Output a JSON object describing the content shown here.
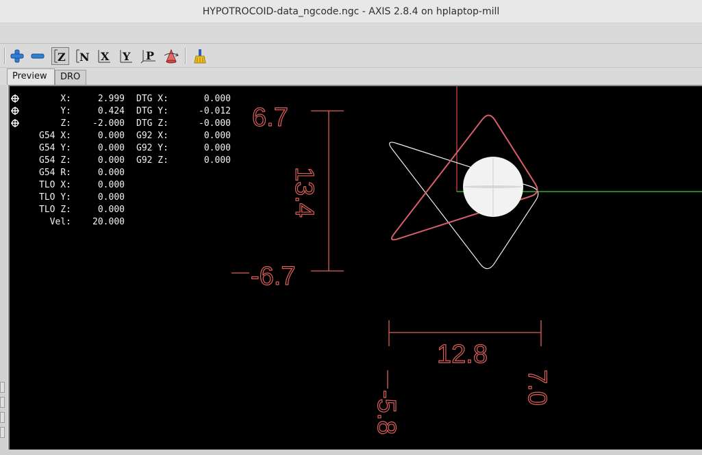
{
  "window": {
    "title": "HYPOTROCOID-data_ngcode.ngc - AXIS 2.8.4 on hplaptop-mill"
  },
  "toolbar": {
    "buttons": [
      {
        "name": "zoom-in-button",
        "icon": "plus-icon"
      },
      {
        "name": "zoom-out-button",
        "icon": "minus-icon"
      },
      {
        "name": "view-z-button",
        "icon": "z-view-icon",
        "label": "Z",
        "active": true
      },
      {
        "name": "view-z-rotated-button",
        "icon": "z-rotated-view-icon",
        "label": "N"
      },
      {
        "name": "view-x-button",
        "icon": "x-view-icon",
        "label": "X"
      },
      {
        "name": "view-y-button",
        "icon": "y-view-icon",
        "label": "Y"
      },
      {
        "name": "view-perspective-button",
        "icon": "perspective-view-icon",
        "label": "P"
      },
      {
        "name": "rotate-view-button",
        "icon": "cone-icon"
      },
      {
        "name": "clear-backplot-button",
        "icon": "broom-icon"
      }
    ]
  },
  "tabs": [
    {
      "label": "Preview",
      "active": true
    },
    {
      "label": "DRO",
      "active": false
    }
  ],
  "dro": {
    "rows": [
      {
        "homed": true,
        "label": "X:",
        "value": "2.999",
        "label2": "DTG X:",
        "value2": "0.000"
      },
      {
        "homed": true,
        "label": "Y:",
        "value": "0.424",
        "label2": "DTG Y:",
        "value2": "-0.012"
      },
      {
        "homed": true,
        "label": "Z:",
        "value": "-2.000",
        "label2": "DTG Z:",
        "value2": "-0.000"
      },
      {
        "homed": false,
        "label": "G54 X:",
        "value": "0.000",
        "label2": "G92 X:",
        "value2": "0.000"
      },
      {
        "homed": false,
        "label": "G54 Y:",
        "value": "0.000",
        "label2": "G92 Y:",
        "value2": "0.000"
      },
      {
        "homed": false,
        "label": "G54 Z:",
        "value": "0.000",
        "label2": "G92 Z:",
        "value2": "0.000"
      },
      {
        "homed": false,
        "label": "G54 R:",
        "value": "0.000",
        "label2": "",
        "value2": ""
      },
      {
        "homed": false,
        "label": "TLO X:",
        "value": "0.000",
        "label2": "",
        "value2": ""
      },
      {
        "homed": false,
        "label": "TLO Y:",
        "value": "0.000",
        "label2": "",
        "value2": ""
      },
      {
        "homed": false,
        "label": "TLO Z:",
        "value": "0.000",
        "label2": "",
        "value2": ""
      },
      {
        "homed": false,
        "label": "Vel:",
        "value": "20.000",
        "label2": "",
        "value2": ""
      }
    ]
  },
  "extents": {
    "y_max": "6.7",
    "y_range": "13.4",
    "y_min": "-6.7",
    "x_range": "12.8",
    "x_min": "-5.8",
    "x_max": "7.0"
  },
  "colors": {
    "dimension": "#e0605a",
    "toolpath_feed": "#d9606a",
    "toolpath_rapid": "#f0f0f0",
    "axis_x": "#3fd040",
    "axis_y": "#e04a4a",
    "tool": "#f2f2f2"
  }
}
